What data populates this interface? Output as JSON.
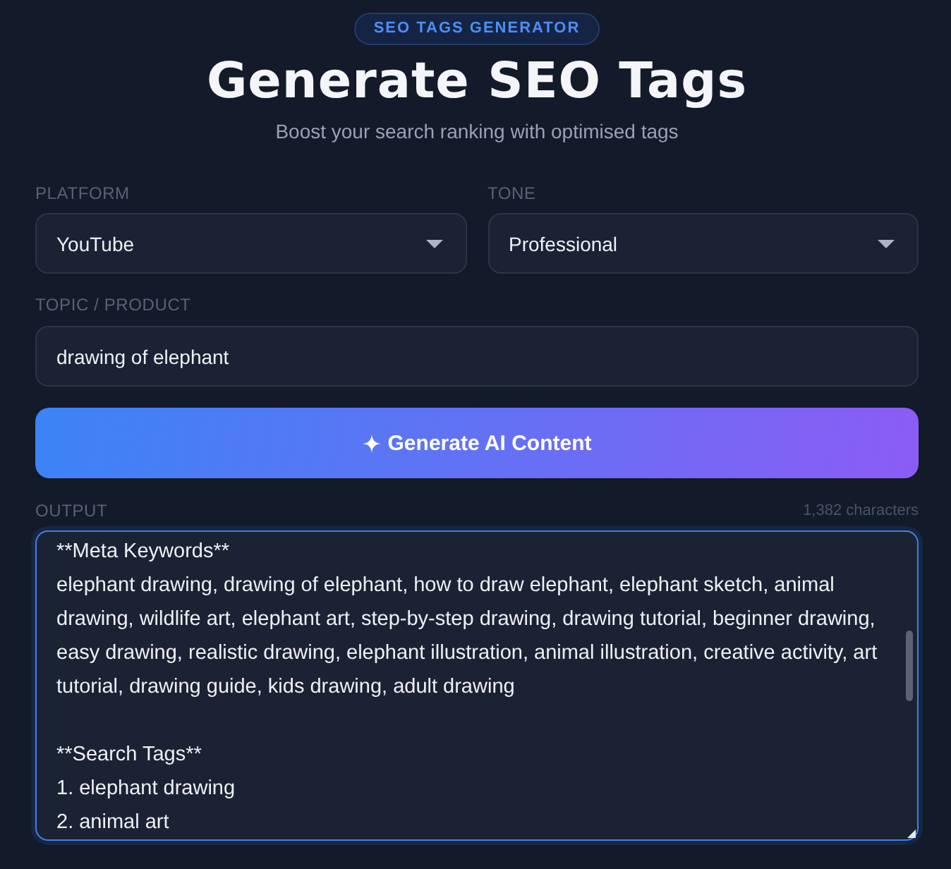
{
  "badge": "SEO TAGS GENERATOR",
  "title": "Generate SEO Tags",
  "subtitle": "Boost your search ranking with optimised tags",
  "fields": [
    {
      "kind": "select",
      "label": "PLATFORM",
      "value": "YouTube"
    },
    {
      "kind": "select",
      "label": "TONE",
      "value": "Professional"
    },
    {
      "kind": "text",
      "label": "TOPIC / PRODUCT",
      "value": "drawing of elephant"
    }
  ],
  "generate_button": {
    "label": "Generate AI Content"
  },
  "output": {
    "label": "OUTPUT",
    "count": "1,382 characters",
    "focused": true,
    "value": "**Meta Keywords**\nelephant drawing, drawing of elephant, how to draw elephant, elephant sketch, animal drawing, wildlife art, elephant art, step-by-step drawing, drawing tutorial, beginner drawing, easy drawing, realistic drawing, elephant illustration, animal illustration, creative activity, art tutorial, drawing guide, kids drawing, adult drawing\n\n**Search Tags**\n1. elephant drawing\n2. animal art"
  }
}
